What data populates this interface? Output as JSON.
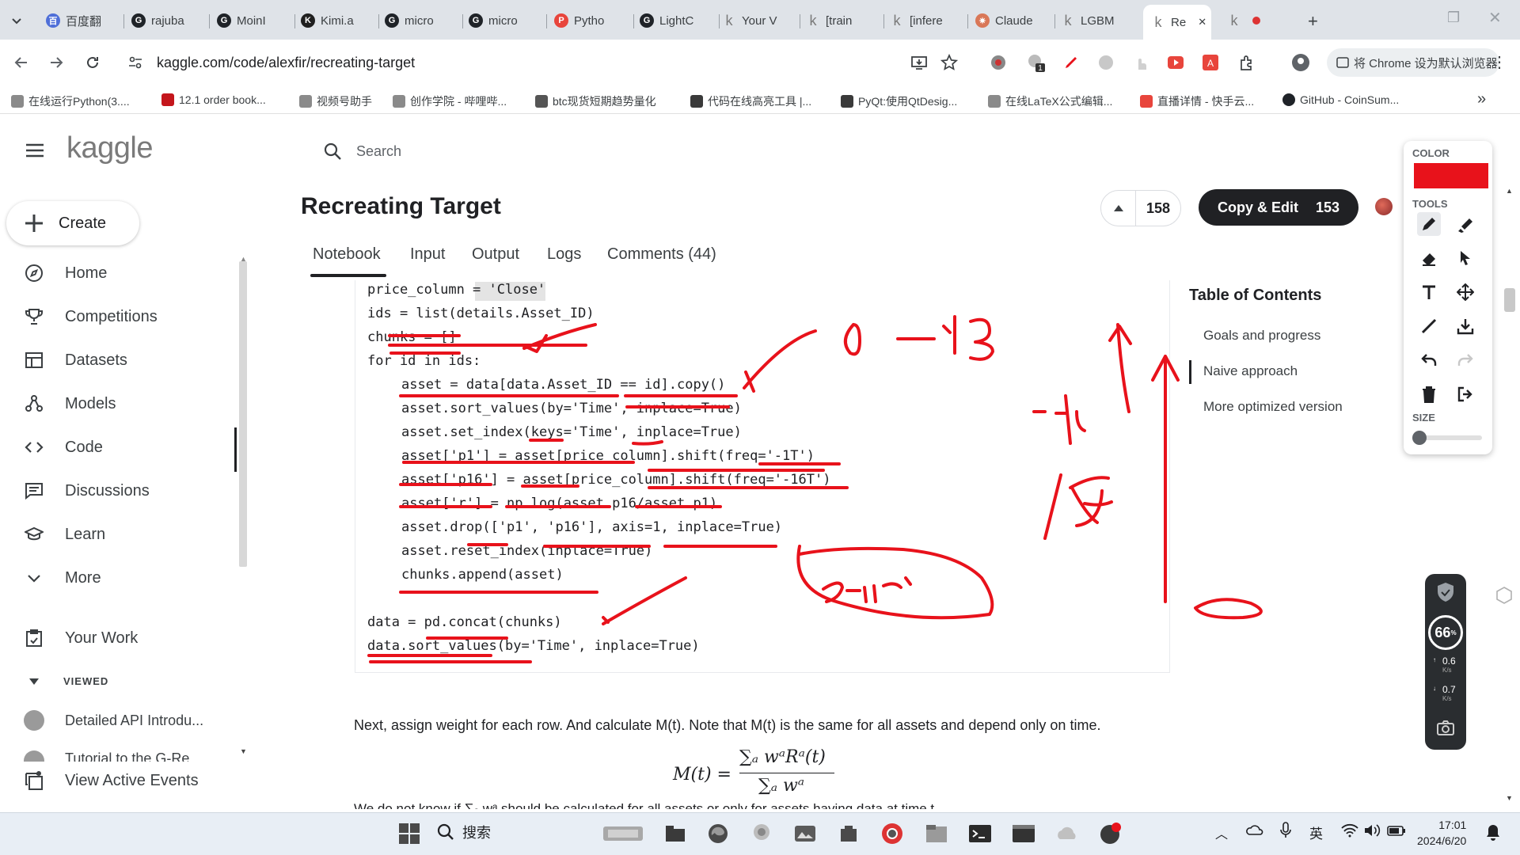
{
  "browser": {
    "tabs": [
      {
        "label": "百度翻",
        "color": "#4f6fd8",
        "glyph": "百"
      },
      {
        "label": "rajuba",
        "color": "#1f2328",
        "glyph": "G"
      },
      {
        "label": "MoinI",
        "color": "#1f2328",
        "glyph": "G"
      },
      {
        "label": "Kimi.a",
        "color": "#1f1f1f",
        "glyph": "K"
      },
      {
        "label": "micro",
        "color": "#1f2328",
        "glyph": "G"
      },
      {
        "label": "micro",
        "color": "#1f2328",
        "glyph": "G"
      },
      {
        "label": "Pytho",
        "color": "#e8453c",
        "glyph": "P"
      },
      {
        "label": "LightC",
        "color": "#1f2328",
        "glyph": "G"
      },
      {
        "label": "Your V",
        "color": "#7a7a7a",
        "glyph": "k"
      },
      {
        "label": "[train",
        "color": "#7a7a7a",
        "glyph": "k"
      },
      {
        "label": "[infere",
        "color": "#7a7a7a",
        "glyph": "k"
      },
      {
        "label": "Claude",
        "color": "#d97757",
        "glyph": "✷"
      },
      {
        "label": "LGBM",
        "color": "#7a7a7a",
        "glyph": "k"
      },
      {
        "label": "Re",
        "color": "#7a7a7a",
        "glyph": "k"
      },
      {
        "label": "",
        "color": "#7a7a7a",
        "glyph": "k"
      }
    ],
    "url": "kaggle.com/code/alexfir/recreating-target",
    "default_browser_label": "将 Chrome 设为默认浏览器",
    "bookmarks": [
      {
        "label": "在线运行Python(3....",
        "color": "#8a8a8a"
      },
      {
        "label": "12.1 order book...",
        "color": "#c4161c"
      },
      {
        "label": "视频号助手",
        "color": "#8a8a8a"
      },
      {
        "label": "创作学院 - 哔哩哔...",
        "color": "#8a8a8a"
      },
      {
        "label": "btc现货短期趋势量化",
        "color": "#555555"
      },
      {
        "label": "代码在线高亮工具 |...",
        "color": "#3a3a3a"
      },
      {
        "label": "PyQt:使用QtDesig...",
        "color": "#3a3a3a"
      },
      {
        "label": "在线LaTeX公式编辑...",
        "color": "#8a8a8a"
      },
      {
        "label": "直播详情 - 快手云...",
        "color": "#e8453c"
      },
      {
        "label": "GitHub - CoinSum...",
        "color": "#1f2328"
      }
    ]
  },
  "kaggle": {
    "logo": "kaggle",
    "search_placeholder": "Search",
    "create_label": "Create",
    "nav": [
      {
        "label": "Home"
      },
      {
        "label": "Competitions"
      },
      {
        "label": "Datasets"
      },
      {
        "label": "Models"
      },
      {
        "label": "Code"
      },
      {
        "label": "Discussions"
      },
      {
        "label": "Learn"
      },
      {
        "label": "More"
      }
    ],
    "your_work": "Your Work",
    "viewed_label": "VIEWED",
    "viewed_items": [
      "Detailed API Introdu...",
      "Tutorial to the G-Re..."
    ],
    "view_active_events": "View Active Events",
    "notebook_title": "Recreating Target",
    "vote_count": "158",
    "copy_edit_label": "Copy & Edit",
    "copy_edit_count": "153",
    "tabs": [
      "Notebook",
      "Input",
      "Output",
      "Logs",
      "Comments (44)"
    ],
    "code_lines": [
      {
        "indent": 0,
        "text": "price_column = 'Close'"
      },
      {
        "indent": 0,
        "text": "ids = list(details.Asset_ID)"
      },
      {
        "indent": 0,
        "text": "chunks = []"
      },
      {
        "indent": 0,
        "text": "for id in ids:"
      },
      {
        "indent": 1,
        "text": "asset = data[data.Asset_ID == id].copy()"
      },
      {
        "indent": 1,
        "text": "asset.sort_values(by='Time', inplace=True)"
      },
      {
        "indent": 1,
        "text": "asset.set_index(keys='Time', inplace=True)"
      },
      {
        "indent": 1,
        "text": "asset['p1'] = asset[price_column].shift(freq='-1T')"
      },
      {
        "indent": 1,
        "text": "asset['p16'] = asset[price_column].shift(freq='-16T')"
      },
      {
        "indent": 1,
        "text": "asset['r'] = np.log(asset.p16/asset.p1)"
      },
      {
        "indent": 1,
        "text": "asset.drop(['p1', 'p16'], axis=1, inplace=True)"
      },
      {
        "indent": 1,
        "text": "asset.reset_index(inplace=True)"
      },
      {
        "indent": 1,
        "text": "chunks.append(asset)"
      },
      {
        "indent": 0,
        "text": ""
      },
      {
        "indent": 0,
        "text": "data = pd.concat(chunks)"
      },
      {
        "indent": 0,
        "text": "data.sort_values(by='Time', inplace=True)"
      }
    ],
    "toc_title": "Table of Contents",
    "toc": [
      {
        "label": "Goals and progress"
      },
      {
        "label": "Naive approach"
      },
      {
        "label": "More optimized version"
      }
    ],
    "paragraph": "Next, assign weight for each row. And calculate M(t). Note that M(t) is the same for all assets and depend only on time.",
    "paragraph2": "We do not know if ∑ₐ wᵃ should be calculated for all assets or only for assets having data at time t.",
    "formula": {
      "lhs": "M(t) =",
      "numerator": "∑ₐ wᵃRᵃ(t)",
      "denominator": "∑ₐ wᵃ"
    }
  },
  "annotations": {
    "ink_color": "#e8121b",
    "texts": [
      "0—13",
      "-1T",
      "16",
      "Senior"
    ]
  },
  "draw_panel": {
    "color_label": "COLOR",
    "color_value": "#e8121b",
    "tools_label": "TOOLS",
    "size_label": "SIZE"
  },
  "net_meter": {
    "percent": "66",
    "up": "0.6",
    "down": "0.7",
    "unit": "K/s"
  },
  "taskbar": {
    "search_label": "搜索",
    "ime": "英",
    "time": "17:01",
    "date": "2024/6/20"
  }
}
